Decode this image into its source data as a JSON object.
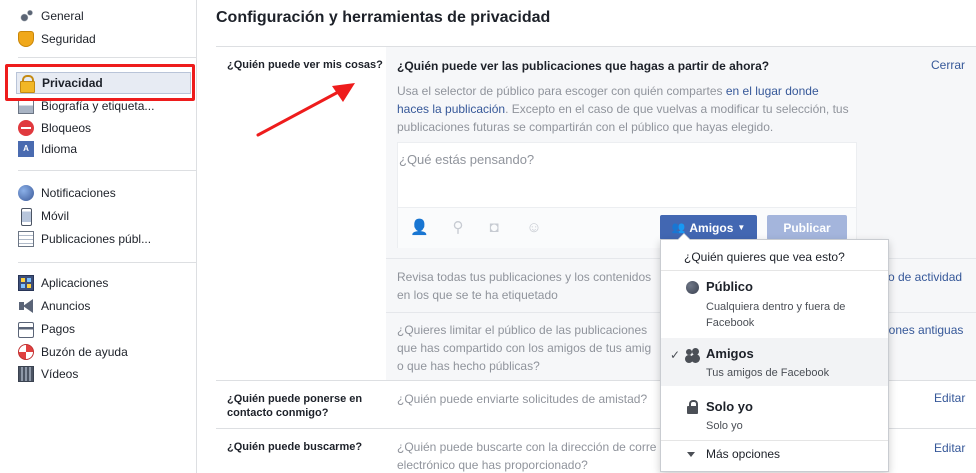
{
  "sidebar": {
    "group1": [
      {
        "label": "General",
        "icon": "gear-icon"
      },
      {
        "label": "Seguridad",
        "icon": "security-badge-icon"
      }
    ],
    "group2": [
      {
        "label": "Privacidad",
        "icon": "privacy-lock-icon",
        "selected": true
      },
      {
        "label": "Biografía y etiqueta...",
        "icon": "timeline-icon"
      },
      {
        "label": "Bloqueos",
        "icon": "block-icon"
      },
      {
        "label": "Idioma",
        "icon": "language-icon"
      }
    ],
    "group3": [
      {
        "label": "Notificaciones",
        "icon": "globe-icon"
      },
      {
        "label": "Móvil",
        "icon": "mobile-phone-icon"
      },
      {
        "label": "Publicaciones públ...",
        "icon": "public-posts-icon"
      }
    ],
    "group4": [
      {
        "label": "Aplicaciones",
        "icon": "apps-icon"
      },
      {
        "label": "Anuncios",
        "icon": "megaphone-icon"
      },
      {
        "label": "Pagos",
        "icon": "credit-card-icon"
      },
      {
        "label": "Buzón de ayuda",
        "icon": "lifebuoy-icon"
      },
      {
        "label": "Vídeos",
        "icon": "film-icon"
      }
    ],
    "highlight_color": "#ee1c1c"
  },
  "main": {
    "title": "Configuración y herramientas de privacidad",
    "section1": {
      "label": "¿Quién puede ver mis cosas?",
      "question": "¿Quién puede ver las publicaciones que hagas a partir de ahora?",
      "close": "Cerrar",
      "desc_1": "Usa el selector de público para escoger con quién compartes",
      "desc_link": "en el lugar donde",
      "desc_link2": "haces la publicación",
      "desc_2": ". Excepto en el caso de que vuelvas a modificar tu selección, tus",
      "desc_3": "publicaciones futuras se compartirán con el público que hayas elegido.",
      "composer_placeholder": "¿Qué estás pensando?",
      "audience_button": "Amigos",
      "publish_button": "Publicar",
      "review_text_1": "Revisa todas tus publicaciones y los contenidos",
      "review_text_2": "en los que se te ha etiquetado",
      "review_link": "ro de actividad",
      "limit_text_1": "¿Quieres limitar el público de las publicaciones",
      "limit_text_2": "que has compartido con los amigos de tus amig",
      "limit_text_3": "o que has hecho públicas?",
      "limit_link": "iones antiguas"
    },
    "section2": {
      "label_1": "¿Quién puede ponerse en",
      "label_2": "contacto conmigo?",
      "question": "¿Quién puede enviarte solicitudes de amistad?",
      "edit": "Editar"
    },
    "section3": {
      "label": "¿Quién puede buscarme?",
      "question_1": "¿Quién puede buscarte con la dirección de corre",
      "question_2": "electrónico que has proporcionado?",
      "edit": "Editar"
    }
  },
  "dropdown": {
    "header": "¿Quién quieres que vea esto?",
    "options": [
      {
        "title": "Público",
        "subtitle": "Cualquiera dentro y fuera de Facebook",
        "icon": "globe-icon",
        "selected": false
      },
      {
        "title": "Amigos",
        "subtitle": "Tus amigos de Facebook",
        "icon": "friends-icon",
        "selected": true
      },
      {
        "title": "Solo yo",
        "subtitle": "Solo yo",
        "icon": "lock-icon",
        "selected": false
      }
    ],
    "more": "Más opciones",
    "check": "✓"
  },
  "colors": {
    "accent": "#4267b2",
    "link": "#365899",
    "arrow": "#ee1c1c"
  }
}
